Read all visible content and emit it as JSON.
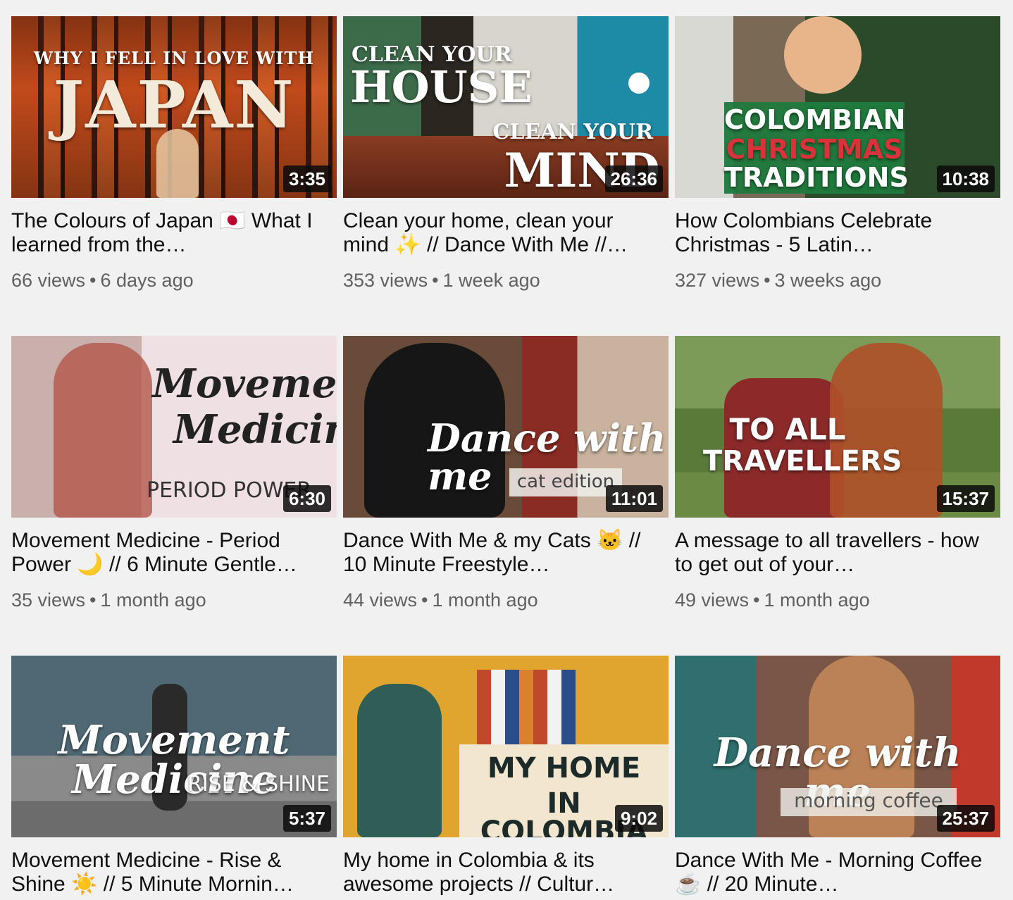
{
  "videos": [
    {
      "overline": "WHY I FELL IN LOVE WITH",
      "headline": "JAPAN",
      "duration": "3:35",
      "title": "The Colours of Japan 🇯🇵 What I learned from the…",
      "views": "66 views",
      "age": "6 days ago",
      "colors": {
        "bg": "#b4451c",
        "accent": "#7a2a10"
      }
    },
    {
      "overline": "CLEAN YOUR",
      "headline": "HOUSE",
      "subline": "CLEAN YOUR",
      "subheadline": "MIND",
      "duration": "26:36",
      "title": "Clean your home, clean your mind ✨  // Dance With Me //…",
      "views": "353 views",
      "age": "1 week ago",
      "colors": {
        "bg": "#2e6f7e",
        "accent": "#6a3b2a"
      }
    },
    {
      "line1": "COLOMBIAN",
      "line2": "CHRISTMAS",
      "line3": "TRADITIONS",
      "duration": "10:38",
      "title": "How Colombians Celebrate Christmas - 5 Latin…",
      "views": "327 views",
      "age": "3 weeks ago",
      "colors": {
        "bg": "#2f5b2f",
        "accent": "#1d6b3a"
      }
    },
    {
      "script1": "Movement",
      "script2": "Medicine",
      "caption": "PERIOD POWER",
      "duration": "6:30",
      "title": "Movement Medicine - Period Power 🌙  // 6 Minute Gentle…",
      "views": "35 views",
      "age": "1 month ago",
      "colors": {
        "bg": "#e9d7da",
        "accent": "#b98a7a"
      }
    },
    {
      "script1": "Dance with me",
      "caption": "cat edition",
      "duration": "11:01",
      "title": "Dance With Me & my Cats 🐱 // 10 Minute Freestyle…",
      "views": "44 views",
      "age": "1 month ago",
      "colors": {
        "bg": "#5a3a2c",
        "accent": "#8b2c24"
      }
    },
    {
      "line1": "TO ALL",
      "line2": "TRAVELLERS",
      "duration": "15:37",
      "title": "A message to all travellers - how to get out of your…",
      "views": "49 views",
      "age": "1 month ago",
      "colors": {
        "bg": "#4f6b34",
        "accent": "#8c2a2a"
      }
    },
    {
      "script1": "Movement Medicine",
      "caption": "RISE & SHINE",
      "duration": "5:37",
      "title": "Movement Medicine - Rise & Shine ☀️  // 5 Minute Mornin…",
      "views": "",
      "age": "",
      "colors": {
        "bg": "#5f7a86",
        "accent": "#8a8a8a"
      }
    },
    {
      "line1": "MY HOME",
      "line2": "IN COLOMBIA",
      "duration": "9:02",
      "title": "My home in Colombia & its awesome projects // Cultur…",
      "views": "",
      "age": "",
      "colors": {
        "bg": "#e0a52e",
        "accent": "#c0492b"
      }
    },
    {
      "script1": "Dance with me",
      "caption": "morning coffee",
      "duration": "25:37",
      "title": "Dance With Me - Morning Coffee ☕  // 20 Minute…",
      "views": "",
      "age": "",
      "colors": {
        "bg": "#7a5646",
        "accent": "#2f6f6f"
      }
    }
  ]
}
